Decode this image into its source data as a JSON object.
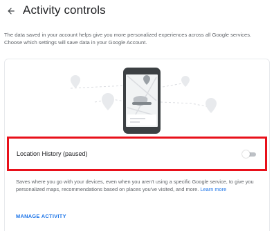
{
  "header": {
    "back_icon": "arrow-back-icon",
    "title": "Activity controls"
  },
  "intro": {
    "text": "The data saved in your account helps give you more personalized experiences across all Google services. Choose which settings will save data in your Google Account."
  },
  "setting": {
    "label": "Location History (paused)",
    "toggle_state": "off",
    "description": "Saves where you go with your devices, even when you aren't using a specific Google service, to give you personalized maps, recommendations based on places you've visited, and more.",
    "learn_more": "Learn more",
    "manage_activity": "MANAGE ACTIVITY"
  },
  "colors": {
    "highlight_border": "#e8101a",
    "link": "#1a73e8",
    "toggle_track_off": "#bdc1c6"
  }
}
